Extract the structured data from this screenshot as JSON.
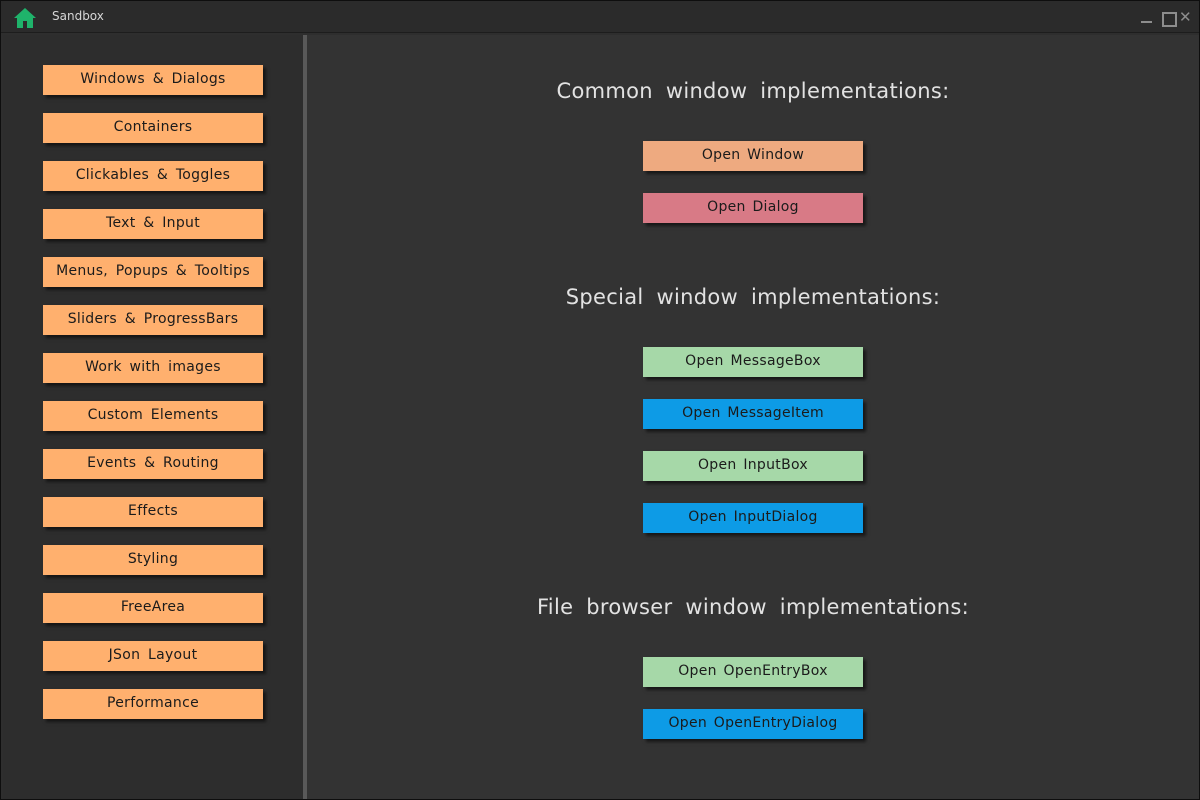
{
  "window": {
    "title": "Sandbox"
  },
  "sidebar": {
    "items": [
      {
        "label": "Windows & Dialogs"
      },
      {
        "label": "Containers"
      },
      {
        "label": "Clickables & Toggles"
      },
      {
        "label": "Text & Input"
      },
      {
        "label": "Menus, Popups & Tooltips"
      },
      {
        "label": "Sliders & ProgressBars"
      },
      {
        "label": "Work with images"
      },
      {
        "label": "Custom Elements"
      },
      {
        "label": "Events & Routing"
      },
      {
        "label": "Effects"
      },
      {
        "label": "Styling"
      },
      {
        "label": "FreeArea"
      },
      {
        "label": "JSon Layout"
      },
      {
        "label": "Performance"
      }
    ]
  },
  "main": {
    "sections": [
      {
        "heading": "Common window implementations:",
        "buttons": [
          {
            "label": "Open Window",
            "color": "#eeaa80"
          },
          {
            "label": "Open Dialog",
            "color": "#d87a86"
          }
        ]
      },
      {
        "heading": "Special window implementations:",
        "buttons": [
          {
            "label": "Open MessageBox",
            "color": "#a6d8a8"
          },
          {
            "label": "Open MessageItem",
            "color": "#0d9be6"
          },
          {
            "label": "Open InputBox",
            "color": "#a6d8a8"
          },
          {
            "label": "Open InputDialog",
            "color": "#0d9be6"
          }
        ]
      },
      {
        "heading": "File browser window implementations:",
        "buttons": [
          {
            "label": "Open OpenEntryBox",
            "color": "#a6d8a8"
          },
          {
            "label": "Open OpenEntryDialog",
            "color": "#0d9be6"
          }
        ]
      }
    ]
  },
  "icons": {
    "home": "home-icon",
    "minimize": "minimize-icon",
    "maximize": "maximize-icon",
    "close": "close-icon"
  },
  "colors": {
    "accent_home": "#1fb36b",
    "sidebar_button": "#ffb06e",
    "background": "#333333"
  }
}
